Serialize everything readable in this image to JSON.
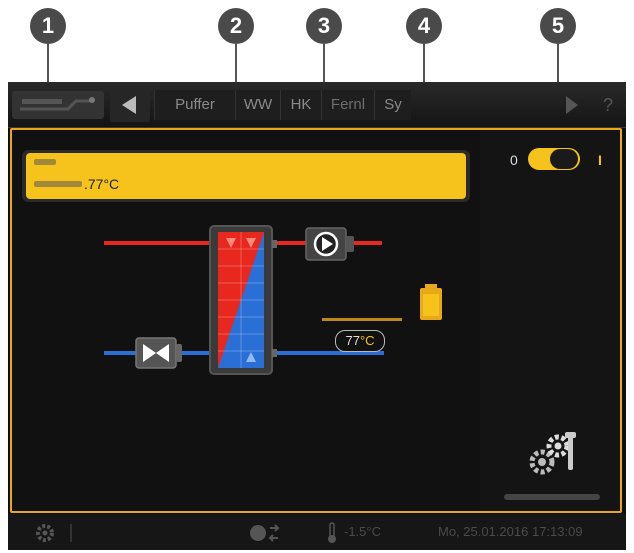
{
  "callouts": [
    "1",
    "2",
    "3",
    "4",
    "5"
  ],
  "tabs": [
    "Puffer",
    "WW",
    "HK",
    "Fernl",
    "Sy"
  ],
  "info": {
    "temperature": ".77°C"
  },
  "toggle": {
    "off_label": "0",
    "on_label": "I"
  },
  "diagram": {
    "temp_value": "77",
    "temp_unit": "°C"
  },
  "status": {
    "outdoor_temp": "-1.5°C",
    "datetime": "Mo, 25.01.2016 17:13:09"
  },
  "icons": {
    "settings": "gear-wrench-icon",
    "pump": "pump-icon",
    "valve": "valve-icon",
    "heat_exchanger": "heat-exchanger-icon",
    "battery": "battery-icon"
  },
  "colors": {
    "accent": "#f6c21c",
    "hot": "#e8281e",
    "cold": "#2a6fd6",
    "border": "#e8a817"
  }
}
